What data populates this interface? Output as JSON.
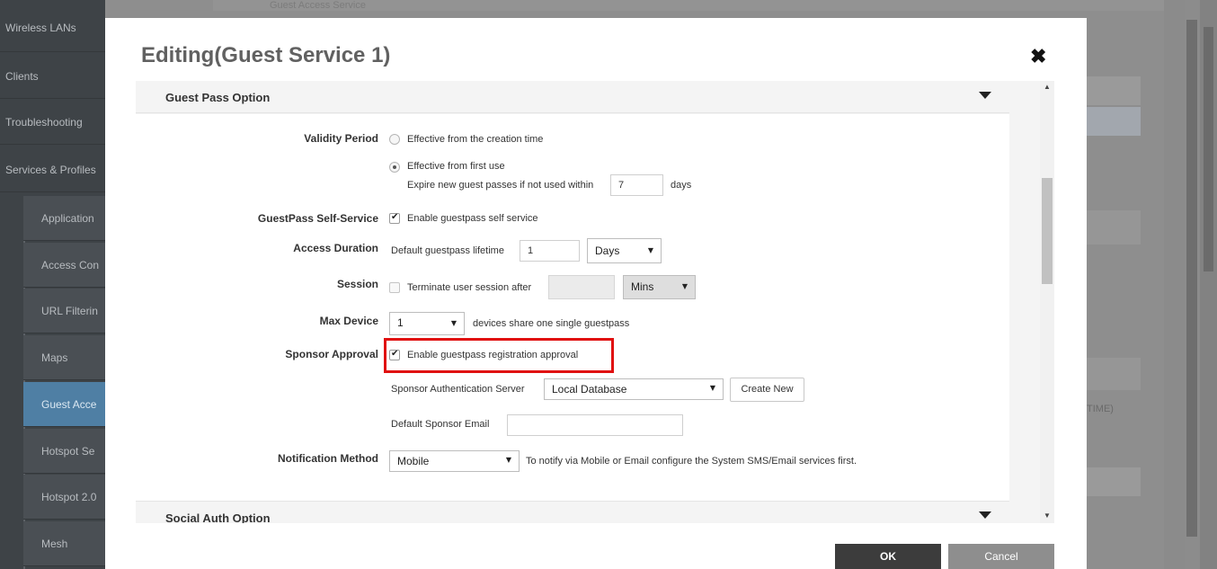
{
  "background": {
    "sidebar_items": [
      "Wireless LANs",
      "Clients",
      "Troubleshooting",
      "Services & Profiles"
    ],
    "sidebar_subitems": [
      "Application",
      "Access Con",
      "URL Filterin",
      "Maps",
      "Guest Acce",
      "Hotspot Se",
      "Hotspot 2.0",
      "Mesh"
    ],
    "page_header": "Guest Access Service",
    "right_text": "TIME)"
  },
  "modal": {
    "title": "Editing(Guest Service 1)",
    "close_glyph": "✖",
    "sections": {
      "guest_pass": "Guest Pass Option",
      "social_auth": "Social Auth Option"
    },
    "validity_period": {
      "label": "Validity Period",
      "option1": "Effective from the creation time",
      "option2": "Effective from first use",
      "expire_prefix": "Expire new guest passes if not used within",
      "expire_value": "7",
      "expire_suffix": "days"
    },
    "self_service": {
      "label": "GuestPass Self-Service",
      "checkbox": "Enable guestpass self service"
    },
    "access_duration": {
      "label": "Access Duration",
      "prefix": "Default guestpass lifetime",
      "value": "1",
      "unit": "Days"
    },
    "session": {
      "label": "Session",
      "checkbox": "Terminate user session after",
      "value": "",
      "unit": "Mins"
    },
    "max_device": {
      "label": "Max Device",
      "value": "1",
      "suffix": "devices share one single guestpass"
    },
    "sponsor_approval": {
      "label": "Sponsor Approval",
      "checkbox": "Enable guestpass registration approval",
      "auth_server_label": "Sponsor Authentication Server",
      "auth_server_value": "Local Database",
      "create_new": "Create New",
      "email_label": "Default Sponsor Email",
      "email_value": ""
    },
    "notification": {
      "label": "Notification Method",
      "value": "Mobile",
      "note": "To notify via Mobile or Email configure the System SMS/Email services first."
    },
    "buttons": {
      "ok": "OK",
      "cancel": "Cancel"
    }
  },
  "colors": {
    "highlight": "#e01010",
    "ok_button": "#3c3c3c",
    "cancel_button": "#8e8e8e"
  }
}
